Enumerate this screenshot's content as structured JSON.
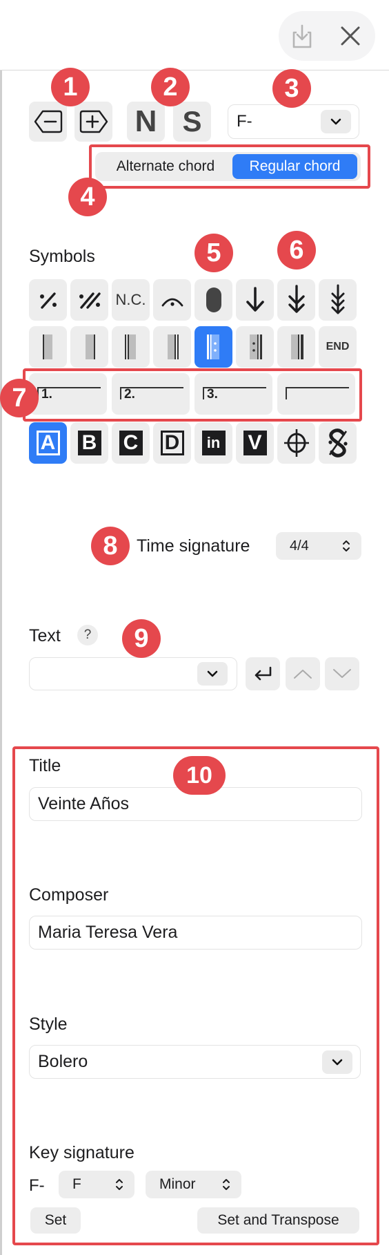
{
  "toolbar": {
    "share_icon": "share-icon",
    "close_icon": "close-icon"
  },
  "badges": [
    "1",
    "2",
    "3",
    "4",
    "5",
    "6",
    "7",
    "8",
    "9",
    "10"
  ],
  "chord": {
    "ns_n": "N",
    "ns_s": "S",
    "select_value": "F-",
    "alternate_label": "Alternate chord",
    "regular_label": "Regular chord"
  },
  "symbols": {
    "label": "Symbols",
    "nc": "N.C.",
    "end": "END",
    "endings": [
      "1.",
      "2.",
      "3.",
      ""
    ],
    "rehearsal": [
      "A",
      "B",
      "C",
      "D",
      "in",
      "V"
    ]
  },
  "time_signature": {
    "label": "Time signature",
    "value": "4/4"
  },
  "text_section": {
    "label": "Text",
    "help": "?"
  },
  "song": {
    "title_label": "Title",
    "title_value": "Veinte Años",
    "composer_label": "Composer",
    "composer_value": "Maria Teresa Vera",
    "style_label": "Style",
    "style_value": "Bolero",
    "key_label": "Key signature",
    "key_current": "F-",
    "key_root": "F",
    "key_mode": "Minor",
    "set_label": "Set",
    "set_transpose_label": "Set and Transpose"
  },
  "colors": {
    "accent": "#2f7cf6",
    "annotation": "#e5484d",
    "button_bg": "#ededed"
  }
}
